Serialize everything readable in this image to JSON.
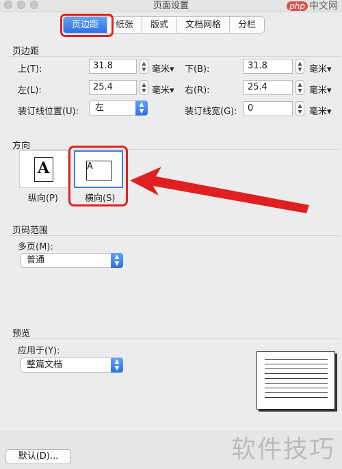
{
  "window": {
    "title": "页面设置"
  },
  "watermark": {
    "top_brand": "php",
    "top_text": "中文网",
    "bottom_text": "软件技巧"
  },
  "tabs": [
    {
      "label": "页边距",
      "active": true
    },
    {
      "label": "纸张",
      "active": false
    },
    {
      "label": "版式",
      "active": false
    },
    {
      "label": "文档网格",
      "active": false
    },
    {
      "label": "分栏",
      "active": false
    }
  ],
  "margins": {
    "header": "页边距",
    "top": {
      "label": "上(T):",
      "value": "31.8",
      "unit": "毫米"
    },
    "bottom": {
      "label": "下(B):",
      "value": "31.8",
      "unit": "毫米"
    },
    "left": {
      "label": "左(L):",
      "value": "25.4",
      "unit": "毫米"
    },
    "right": {
      "label": "右(R):",
      "value": "25.4",
      "unit": "毫米"
    },
    "gutter_position": {
      "label": "装订线位置(U):",
      "value": "左"
    },
    "gutter_width": {
      "label": "装订线宽(G):",
      "value": "0",
      "unit": "毫米"
    }
  },
  "orientation": {
    "header": "方向",
    "portrait": {
      "label": "纵向(P)",
      "glyph": "A"
    },
    "landscape": {
      "label": "横向(S)",
      "glyph": "A",
      "selected": true
    }
  },
  "pages": {
    "header": "页码范围",
    "multiple_label": "多页(M):",
    "multiple_value": "普通"
  },
  "preview": {
    "header": "预览",
    "apply_label": "应用于(Y):",
    "apply_value": "整篇文档"
  },
  "buttons": {
    "default": "默认(D)..."
  },
  "colors": {
    "accent": "#2f6fe6",
    "annotation": "#e02020"
  },
  "icons": {
    "stepper": "stepper-arrows-icon",
    "select": "select-arrows-icon",
    "arrow": "red-arrow-annotation"
  }
}
